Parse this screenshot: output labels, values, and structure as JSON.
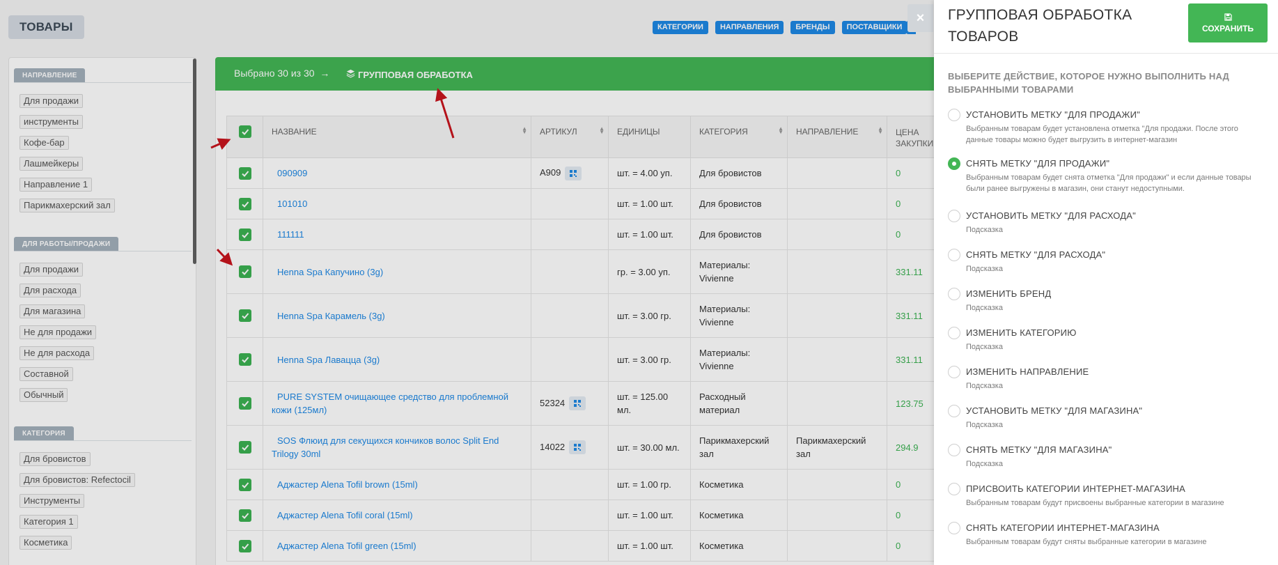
{
  "page": {
    "title": "ТОВАРЫ",
    "top_buttons": [
      "КАТЕГОРИИ",
      "НАПРАВЛЕНИЯ",
      "БРЕНДЫ",
      "ПОСТАВЩИКИ"
    ]
  },
  "sidebar": {
    "sections": [
      {
        "title": "НАПРАВЛЕНИЕ",
        "items": [
          "Для продажи",
          "инструменты",
          "Кофе-бар",
          "Лашмейкеры",
          "Направление 1",
          "Парикмахерский зал"
        ]
      },
      {
        "title": "ДЛЯ РАБОТЫ/ПРОДАЖИ",
        "items": [
          "Для продажи",
          "Для расхода",
          "Для магазина",
          "Не для продажи",
          "Не для расхода",
          "Составной",
          "Обычный"
        ]
      },
      {
        "title": "КАТЕГОРИЯ",
        "items": [
          "Для бровистов",
          "Для бровистов: Refectocil",
          "Инструменты",
          "Категория 1",
          "Косметика"
        ]
      }
    ]
  },
  "selection_bar": {
    "selected_text": "Выбрано 30 из 30",
    "arrow": "→",
    "group_label": "ГРУППОВАЯ ОБРАБОТКА",
    "group_icon": "layers-icon"
  },
  "table": {
    "columns": [
      "НАЗВАНИЕ",
      "АРТИКУЛ",
      "ЕДИНИЦЫ",
      "КАТЕГОРИЯ",
      "НАПРАВЛЕНИЕ",
      "ЦЕНА ЗАКУПКИ"
    ],
    "rows": [
      {
        "name": "090909",
        "article": "A909",
        "qr": true,
        "units": "шт. = 4.00 уп.",
        "category": "Для бровистов",
        "direction": "",
        "price": "0"
      },
      {
        "name": "101010",
        "article": "",
        "qr": false,
        "units": "шт. = 1.00 шт.",
        "category": "Для бровистов",
        "direction": "",
        "price": "0"
      },
      {
        "name": "111111",
        "article": "",
        "qr": false,
        "units": "шт. = 1.00 шт.",
        "category": "Для бровистов",
        "direction": "",
        "price": "0"
      },
      {
        "name": "Henna Spa Капучино (3g)",
        "article": "",
        "qr": false,
        "units": "гр. = 3.00 уп.",
        "category": "Материалы: Vivienne",
        "direction": "",
        "price": "331.11"
      },
      {
        "name": "Henna Spa Карамель (3g)",
        "article": "",
        "qr": false,
        "units": "шт. = 3.00 гр.",
        "category": "Материалы: Vivienne",
        "direction": "",
        "price": "331.11"
      },
      {
        "name": "Henna Spa Лавацца (3g)",
        "article": "",
        "qr": false,
        "units": "шт. = 3.00 гр.",
        "category": "Материалы: Vivienne",
        "direction": "",
        "price": "331.11"
      },
      {
        "name": "PURE SYSTEM очищающее средство для проблемной кожи (125мл)",
        "article": "52324",
        "qr": true,
        "units": "шт. = 125.00 мл.",
        "category": "Расходный материал",
        "direction": "",
        "price": "123.75"
      },
      {
        "name": "SOS Флюид для секущихся кончиков волос Split End Trilogy 30ml",
        "article": "14022",
        "qr": true,
        "units": "шт. = 30.00 мл.",
        "category": "Парикмахерский зал",
        "direction": "Парикмахерский зал",
        "price": "294.9"
      },
      {
        "name": "Аджастер Alena Tofil brown (15ml)",
        "article": "",
        "qr": false,
        "units": "шт. = 1.00 гр.",
        "category": "Косметика",
        "direction": "",
        "price": "0"
      },
      {
        "name": "Аджастер Alena Tofil coral (15ml)",
        "article": "",
        "qr": false,
        "units": "шт. = 1.00 шт.",
        "category": "Косметика",
        "direction": "",
        "price": "0"
      },
      {
        "name": "Аджастер Alena Tofil green (15ml)",
        "article": "",
        "qr": false,
        "units": "шт. = 1.00 шт.",
        "category": "Косметика",
        "direction": "",
        "price": "0"
      }
    ]
  },
  "panel": {
    "close_label": "×",
    "title": "ГРУППОВАЯ ОБРАБОТКА ТОВАРОВ",
    "save_label": "СОХРАНИТЬ",
    "save_icon": "floppy-disk-icon",
    "prompt": "ВЫБЕРИТЕ ДЕЙСТВИЕ, КОТОРОЕ НУЖНО ВЫПОЛНИТЬ НАД ВЫБРАННЫМИ ТОВАРАМИ",
    "options": [
      {
        "label": "УСТАНОВИТЬ МЕТКУ \"ДЛЯ ПРОДАЖИ\"",
        "desc": "Выбранным товарам будет установлена отметка \"Для продажи. После этого данные товары можно будет выгрузить в интернет-магазин",
        "selected": false
      },
      {
        "label": "СНЯТЬ МЕТКУ \"ДЛЯ ПРОДАЖИ\"",
        "desc": "Выбранным товарам будет снята отметка \"Для продажи\" и если данные товары были ранее выгружены в магазин, они станут недоступными.",
        "selected": true
      },
      {
        "label": "УСТАНОВИТЬ МЕТКУ \"ДЛЯ РАСХОДА\"",
        "desc": "Подсказка",
        "selected": false
      },
      {
        "label": "СНЯТЬ МЕТКУ \"ДЛЯ РАСХОДА\"",
        "desc": "Подсказка",
        "selected": false
      },
      {
        "label": "ИЗМЕНИТЬ БРЕНД",
        "desc": "Подсказка",
        "selected": false
      },
      {
        "label": "ИЗМЕНИТЬ КАТЕГОРИЮ",
        "desc": "Подсказка",
        "selected": false
      },
      {
        "label": "ИЗМЕНИТЬ НАПРАВЛЕНИЕ",
        "desc": "Подсказка",
        "selected": false
      },
      {
        "label": "УСТАНОВИТЬ МЕТКУ \"ДЛЯ МАГАЗИНА\"",
        "desc": "Подсказка",
        "selected": false
      },
      {
        "label": "СНЯТЬ МЕТКУ \"ДЛЯ МАГАЗИНА\"",
        "desc": "Подсказка",
        "selected": false
      },
      {
        "label": "ПРИСВОИТЬ КАТЕГОРИИ ИНТЕРНЕТ-МАГАЗИНА",
        "desc": "Выбранным товарам будут присвоены выбранные категории в магазине",
        "selected": false
      },
      {
        "label": "СНЯТЬ КАТЕГОРИИ ИНТЕРНЕТ-МАГАЗИНА",
        "desc": "Выбранным товарам будут сняты выбранные категории в магазине",
        "selected": false
      }
    ]
  },
  "colors": {
    "accent_green": "#43b655",
    "accent_blue": "#1e88e5",
    "annotation_red": "#c9151e"
  }
}
